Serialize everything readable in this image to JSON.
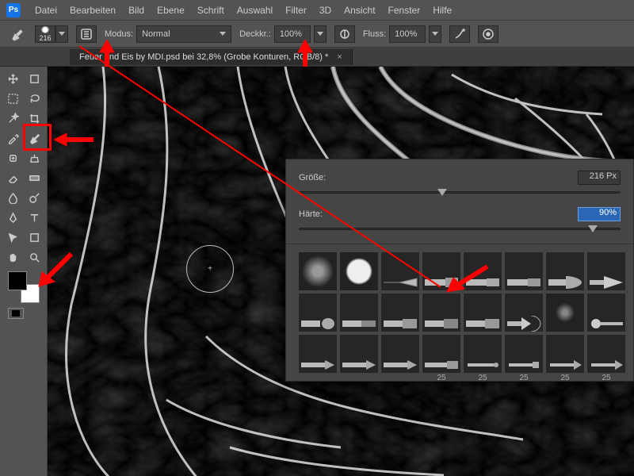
{
  "menubar": [
    "Datei",
    "Bearbeiten",
    "Bild",
    "Ebene",
    "Schrift",
    "Auswahl",
    "Filter",
    "3D",
    "Ansicht",
    "Fenster",
    "Hilfe"
  ],
  "options": {
    "brush_size": "216",
    "mode_label": "Modus:",
    "mode_value": "Normal",
    "opacity_label": "Deckkr.:",
    "opacity_value": "100%",
    "flow_label": "Fluss:",
    "flow_value": "100%"
  },
  "tab": {
    "title": "Feuer und Eis by MDI.psd bei 32,8% (Grobe Konturen, RGB/8) *",
    "close": "×"
  },
  "brush_panel": {
    "size_label": "Größe:",
    "size_value": "216 Px",
    "size_thumb_pct": 43,
    "hardness_label": "Härte:",
    "hardness_value": "90%",
    "hardness_thumb_pct": 90,
    "grid_labels": [
      "25",
      "25",
      "25",
      "25",
      "25"
    ]
  },
  "colors": {
    "fg": "#000000",
    "bg": "#ffffff"
  }
}
